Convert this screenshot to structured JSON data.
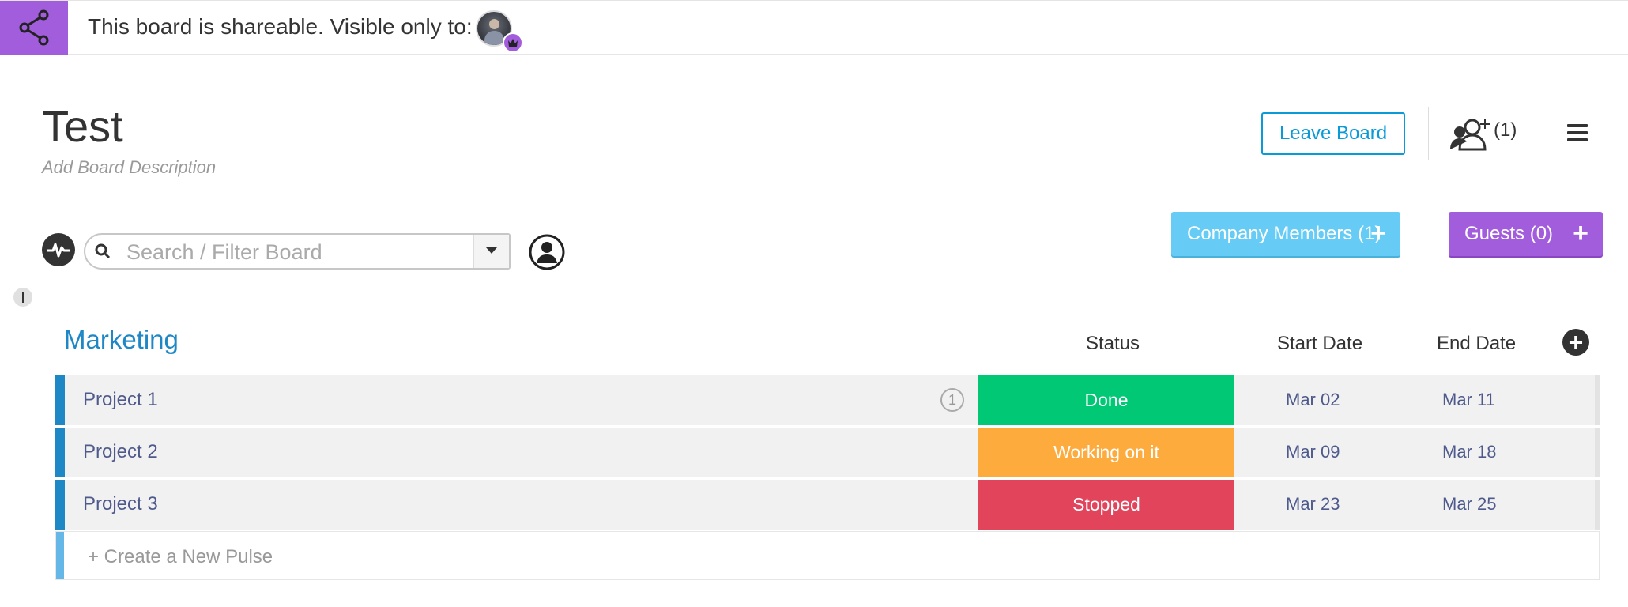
{
  "banner": {
    "text": "This board is shareable. Visible only to:",
    "accent_color": "#a25ddc",
    "icon": "share-icon"
  },
  "board": {
    "title": "Test",
    "description_placeholder": "Add Board Description"
  },
  "header_actions": {
    "leave_label": "Leave Board",
    "members_count": "(1)",
    "menu_icon": "hamburger-icon"
  },
  "toolbar": {
    "search_placeholder": "Search / Filter Board",
    "company_members_label": "Company Members (1)",
    "guests_label": "Guests (0)",
    "plus": "+"
  },
  "group": {
    "title": "Marketing",
    "color": "#1e88c7",
    "columns": {
      "status": "Status",
      "start": "Start Date",
      "end": "End Date"
    },
    "rows": [
      {
        "name": "Project 1",
        "updates": "1",
        "status": "Done",
        "status_color": "#00c875",
        "start": "Mar 02",
        "end": "Mar 11"
      },
      {
        "name": "Project 2",
        "status": "Working on it",
        "status_color": "#fdab3d",
        "start": "Mar 09",
        "end": "Mar 18"
      },
      {
        "name": "Project 3",
        "status": "Stopped",
        "status_color": "#e2445c",
        "start": "Mar 23",
        "end": "Mar 25"
      }
    ],
    "new_pulse_label": "+ Create a New Pulse"
  }
}
